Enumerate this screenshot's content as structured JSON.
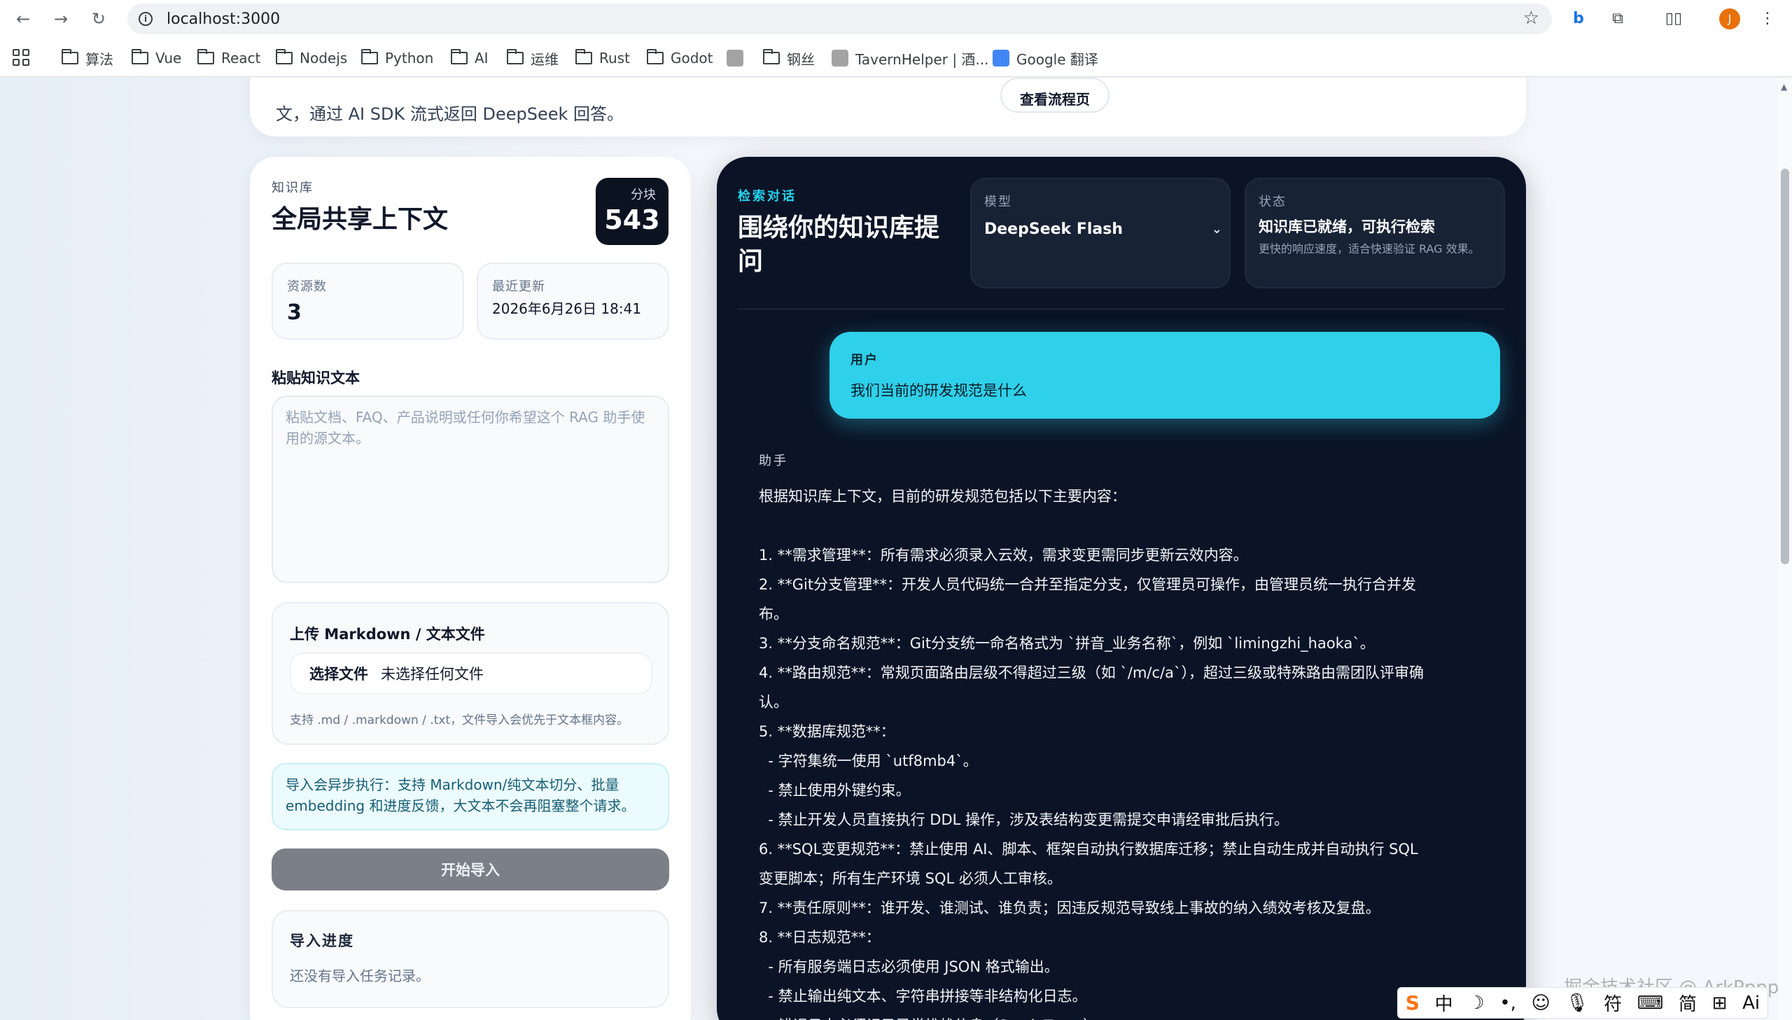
{
  "browser": {
    "url": "localhost:3000",
    "profile_initial": "J",
    "bookmarks": [
      {
        "label": "算法",
        "icon": "folder-icon"
      },
      {
        "label": "Vue",
        "icon": "folder-icon"
      },
      {
        "label": "React",
        "icon": "folder-icon"
      },
      {
        "label": "Nodejs",
        "icon": "folder-icon"
      },
      {
        "label": "Python",
        "icon": "folder-icon"
      },
      {
        "label": "AI",
        "icon": "folder-icon"
      },
      {
        "label": "运维",
        "icon": "folder-icon"
      },
      {
        "label": "Rust",
        "icon": "folder-icon"
      },
      {
        "label": "Godot",
        "icon": "folder-icon"
      },
      {
        "label": "",
        "icon": "favicon-icon"
      },
      {
        "label": "钢丝",
        "icon": "folder-icon"
      },
      {
        "label": "TavernHelper | 酒...",
        "icon": "favicon-icon"
      },
      {
        "label": "Google 翻译",
        "icon": "translate-icon"
      }
    ]
  },
  "hero": {
    "description": "文，通过 AI SDK 流式返回 DeepSeek 回答。",
    "flow_button": "查看流程页"
  },
  "knowledge": {
    "section_label": "知识库",
    "title": "全局共享上下文",
    "chunks_label": "分块",
    "chunks_value": "543",
    "resources_label": "资源数",
    "resources_value": "3",
    "updated_label": "最近更新",
    "updated_value": "2026年6月26日 18:41",
    "paste_label": "粘贴知识文本",
    "paste_placeholder": "粘贴文档、FAQ、产品说明或任何你希望这个 RAG 助手使用的源文本。",
    "upload_title": "上传 Markdown / 文本文件",
    "choose_file": "选择文件",
    "no_file": "未选择任何文件",
    "upload_hint": "支持 .md / .markdown / .txt，文件导入会优先于文本框内容。",
    "notice": "导入会异步执行：支持 Markdown/纯文本切分、批量 embedding 和进度反馈，大文本不会再阻塞整个请求。",
    "import_button": "开始导入",
    "progress_title": "导入进度",
    "progress_empty": "还没有导入任务记录。"
  },
  "chat": {
    "section_label": "检索对话",
    "title": "围绕你的知识库提问",
    "model_label": "模型",
    "model_value": "DeepSeek Flash",
    "status_label": "状态",
    "status_main": "知识库已就绪，可执行检索",
    "status_sub": "更快的响应速度，适合快速验证 RAG 效果。",
    "user_role": "用户",
    "user_message": "我们当前的研发规范是什么",
    "assistant_role": "助手",
    "assistant_lines": [
      "根据知识库上下文，目前的研发规范包括以下主要内容：",
      "",
      "1. **需求管理**：所有需求必须录入云效，需求变更需同步更新云效内容。",
      "2. **Git分支管理**：开发人员代码统一合并至指定分支，仅管理员可操作，由管理员统一执行合并发布。",
      "3. **分支命名规范**：Git分支统一命名格式为 `拼音_业务名称`，例如 `limingzhi_haoka`。",
      "4. **路由规范**：常规页面路由层级不得超过三级（如 `/m/c/a`），超过三级或特殊路由需团队评审确认。",
      "5. **数据库规范**：",
      "  - 字符集统一使用 `utf8mb4`。",
      "  - 禁止使用外键约束。",
      "  - 禁止开发人员直接执行 DDL 操作，涉及表结构变更需提交申请经审批后执行。",
      "6. **SQL变更规范**：禁止使用 AI、脚本、框架自动执行数据库迁移；禁止自动生成并自动执行 SQL 变更脚本；所有生产环境 SQL 必须人工审核。",
      "7. **责任原则**：谁开发、谁测试、谁负责；因违反规范导致线上事故的纳入绩效考核及复盘。",
      "8. **日志规范**：",
      "  - 所有服务端日志必须使用 JSON 格式输出。",
      "  - 禁止输出纯文本、字符串拼接等非结构化日志。",
      "  - 错误日志必须记录异常堆栈信息（Stack Trace）"
    ]
  },
  "ime": {
    "items": [
      "S",
      "中",
      "☽",
      "•,",
      "☺",
      "🎙",
      "符",
      "⌨",
      "简",
      "⊞",
      "Ai"
    ]
  },
  "watermark": "掘金技术社区 @ ArkPppp"
}
